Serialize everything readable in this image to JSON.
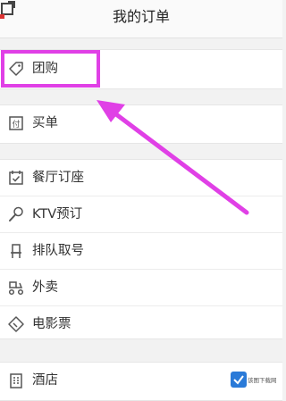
{
  "header": {
    "title": "我的订单"
  },
  "groups": [
    {
      "items": [
        {
          "label": "团购",
          "icon": "tag-icon"
        }
      ]
    },
    {
      "items": [
        {
          "label": "买单",
          "icon": "receipt-icon"
        }
      ]
    },
    {
      "items": [
        {
          "label": "餐厅订座",
          "icon": "calendar-check-icon"
        },
        {
          "label": "KTV预订",
          "icon": "microphone-icon"
        },
        {
          "label": "排队取号",
          "icon": "queue-icon"
        },
        {
          "label": "外卖",
          "icon": "scooter-icon"
        },
        {
          "label": "电影票",
          "icon": "ticket-icon"
        }
      ]
    },
    {
      "items": [
        {
          "label": "酒店",
          "icon": "building-icon"
        }
      ]
    }
  ],
  "annotation": {
    "color": "#e040e6"
  },
  "watermark": {
    "text": "该图下载网"
  },
  "colors": {
    "background": "#f2f2f2",
    "panel": "#ffffff",
    "text": "#333333"
  }
}
